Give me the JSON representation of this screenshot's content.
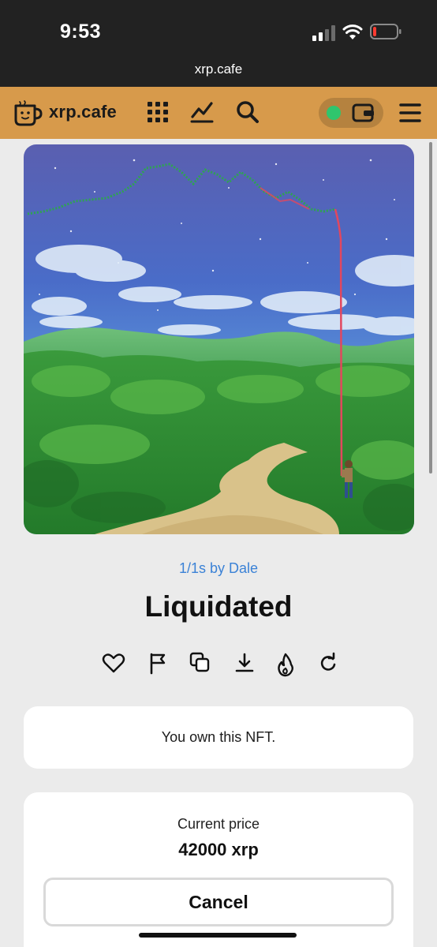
{
  "status_bar": {
    "time": "9:53",
    "icons": [
      "cellular-signal-icon",
      "wifi-icon",
      "battery-low-icon"
    ]
  },
  "browser": {
    "url": "xrp.cafe"
  },
  "header": {
    "logo_text": "xrp.cafe",
    "icons": [
      "mug-logo-icon",
      "grid-icon",
      "chart-icon",
      "search-icon",
      "wallet-icon",
      "menu-icon"
    ],
    "wallet_connected": true,
    "colors": {
      "bar": "#d79a4b",
      "status_dot": "#2fc56d"
    }
  },
  "nft": {
    "collection_link": "1/1s by Dale",
    "title": "Liquidated",
    "actions": [
      "heart-icon",
      "flag-icon",
      "copy-icon",
      "download-icon",
      "burn-icon",
      "refresh-icon"
    ]
  },
  "ownership": {
    "message": "You own this NFT."
  },
  "pricing": {
    "label": "Current price",
    "value": "42000 xrp",
    "cancel_label": "Cancel"
  }
}
